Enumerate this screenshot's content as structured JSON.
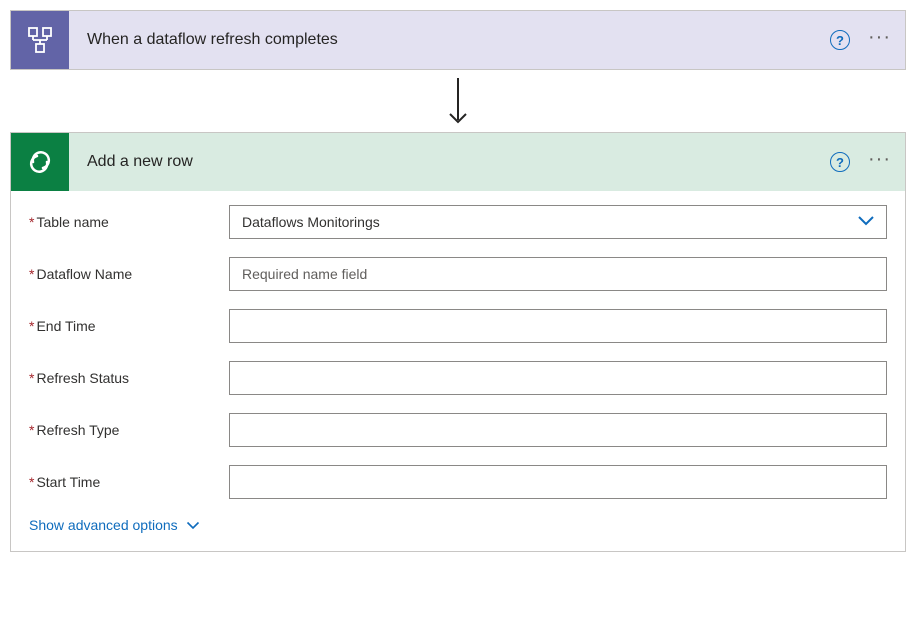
{
  "trigger": {
    "title": "When a dataflow refresh completes"
  },
  "action": {
    "title": "Add a new row",
    "fields": {
      "table_name": {
        "label": "Table name",
        "value": "Dataflows Monitorings"
      },
      "dataflow_name": {
        "label": "Dataflow Name",
        "placeholder": "Required name field",
        "value": ""
      },
      "end_time": {
        "label": "End Time",
        "value": ""
      },
      "refresh_status": {
        "label": "Refresh Status",
        "value": ""
      },
      "refresh_type": {
        "label": "Refresh Type",
        "value": ""
      },
      "start_time": {
        "label": "Start Time",
        "value": ""
      }
    },
    "advanced_label": "Show advanced options"
  }
}
